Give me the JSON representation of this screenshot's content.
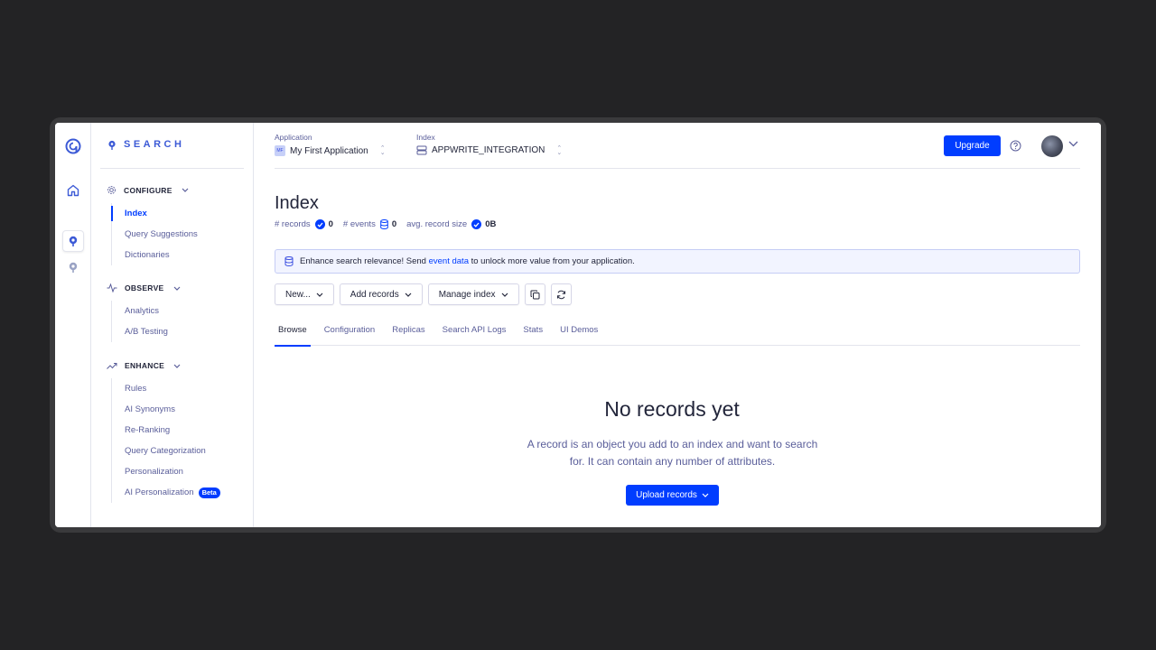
{
  "brand": {
    "name": "SEARCH"
  },
  "rail": {
    "items": [
      "algolia-logo-icon",
      "home-icon",
      "search-product-icon",
      "recommend-product-icon"
    ]
  },
  "sidebar": {
    "configure": {
      "label": "CONFIGURE",
      "items": [
        {
          "label": "Index",
          "active": true
        },
        {
          "label": "Query Suggestions"
        },
        {
          "label": "Dictionaries"
        }
      ]
    },
    "observe": {
      "label": "OBSERVE",
      "items": [
        {
          "label": "Analytics"
        },
        {
          "label": "A/B Testing"
        }
      ]
    },
    "enhance": {
      "label": "ENHANCE",
      "items": [
        {
          "label": "Rules"
        },
        {
          "label": "AI Synonyms"
        },
        {
          "label": "Re-Ranking"
        },
        {
          "label": "Query Categorization"
        },
        {
          "label": "Personalization"
        },
        {
          "label": "AI Personalization",
          "badge": "Beta"
        }
      ]
    }
  },
  "header": {
    "application": {
      "label": "Application",
      "value": "My First Application",
      "badge": "MF"
    },
    "index": {
      "label": "Index",
      "value": "APPWRITE_INTEGRATION"
    },
    "upgrade_label": "Upgrade"
  },
  "page": {
    "title": "Index",
    "stats": {
      "records_label": "# records",
      "records_value": "0",
      "events_label": "# events",
      "events_value": "0",
      "size_label": "avg. record size",
      "size_value": "0B"
    },
    "banner": {
      "prefix": "Enhance search relevance! Send",
      "link": "event data",
      "suffix": "to unlock more value from your application."
    },
    "toolbar": {
      "new_label": "New...",
      "add_records_label": "Add records",
      "manage_index_label": "Manage index"
    },
    "tabs": [
      "Browse",
      "Configuration",
      "Replicas",
      "Search API Logs",
      "Stats",
      "UI Demos"
    ],
    "active_tab": "Browse",
    "empty": {
      "title": "No records yet",
      "description": "A record is an object you add to an index and want to search for. It can contain any number of attributes.",
      "upload_label": "Upload records"
    }
  },
  "colors": {
    "accent": "#003dff",
    "text": "#23263b",
    "muted": "#5a5e9a",
    "backdrop": "#232325"
  }
}
